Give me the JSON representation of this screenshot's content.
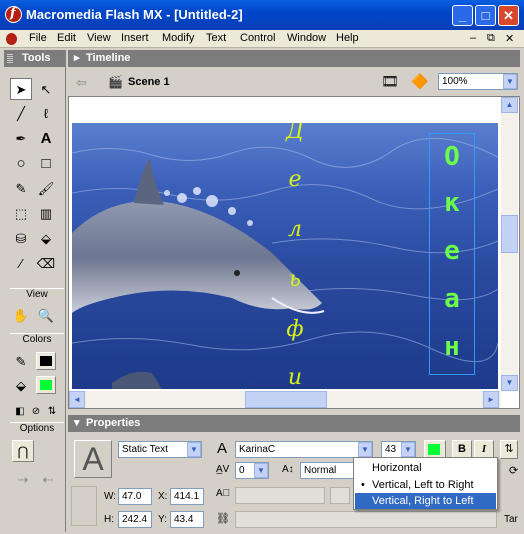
{
  "window": {
    "title": "Macromedia Flash MX - [Untitled-2]"
  },
  "menu": [
    "File",
    "Edit",
    "View",
    "Insert",
    "Modify",
    "Text",
    "Control",
    "Window",
    "Help"
  ],
  "tools_panel": {
    "title": "Tools",
    "sections": {
      "view": "View",
      "colors": "Colors",
      "options": "Options"
    }
  },
  "timeline": {
    "title": "Timeline",
    "scene": "Scene 1",
    "zoom": "100%"
  },
  "stage": {
    "vertical_text_green": [
      "О",
      "к",
      "е",
      "а",
      "н"
    ],
    "vertical_text_yellow": [
      "Д",
      "е",
      "л",
      "ь",
      "ф",
      "и"
    ],
    "text_color": "#6cff4a",
    "scroll_up": "▲",
    "scroll_down": "▼",
    "scroll_left": "◄",
    "scroll_right": "►"
  },
  "properties": {
    "title": "Properties",
    "text_type": "Static Text",
    "font": "KarinaC",
    "font_size": "43",
    "kerning_value": "0",
    "position": "Normal",
    "w_label": "W:",
    "w": "47.0",
    "x_label": "X:",
    "x": "414.1",
    "h_label": "H:",
    "h": "242.4",
    "y_label": "Y:",
    "y": "43.4",
    "bold": "B",
    "italic": "I",
    "cut_label": "Tar",
    "fill_color": "#00ff33"
  },
  "direction_menu": {
    "items": [
      "Horizontal",
      "Vertical, Left to Right",
      "Vertical, Right to Left"
    ],
    "checked_index": 1,
    "highlighted_index": 2
  }
}
